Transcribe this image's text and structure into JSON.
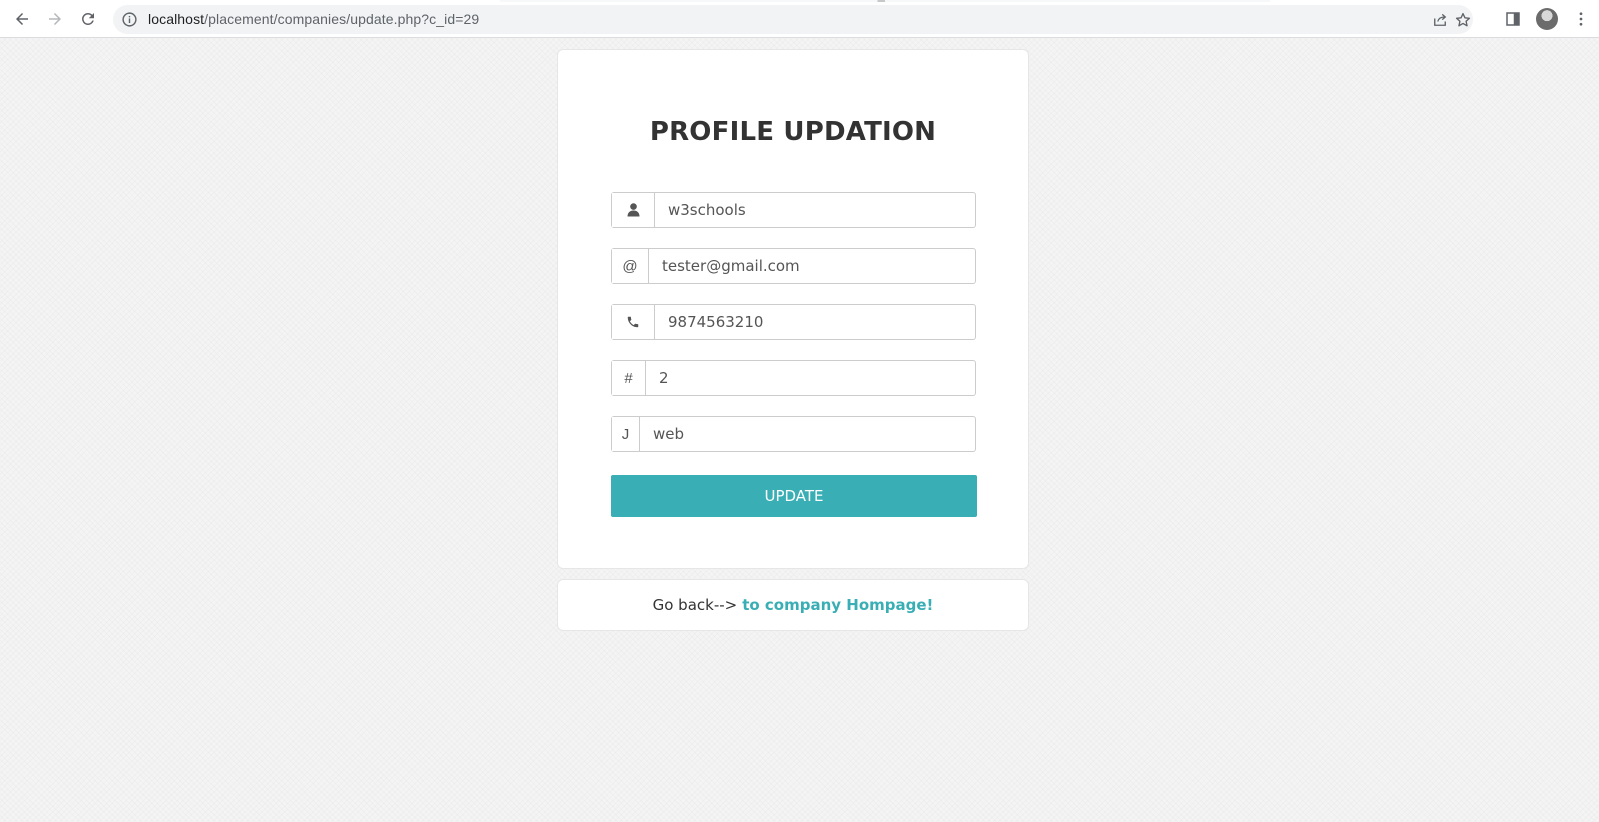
{
  "browser": {
    "url_host": "localhost",
    "url_path": "/placement/companies/update.php?c_id=29"
  },
  "form": {
    "title": "PROFILE UPDATION",
    "fields": [
      {
        "icon": "user-icon",
        "addon_text": "",
        "value": "w3schools"
      },
      {
        "icon": "at-icon",
        "addon_text": "@",
        "value": "tester@gmail.com"
      },
      {
        "icon": "phone-icon",
        "addon_text": "",
        "value": "9874563210"
      },
      {
        "icon": "hash-icon",
        "addon_text": "#",
        "value": "2"
      },
      {
        "icon": "j-icon",
        "addon_text": "J",
        "value": "web"
      }
    ],
    "submit_label": "UPDATE"
  },
  "footer": {
    "prefix": "Go back-->",
    "link_label": "to company Hompage!"
  },
  "colors": {
    "accent": "#39aeb5",
    "background": "#f4f4f4",
    "card": "#ffffff",
    "title": "#333333"
  }
}
